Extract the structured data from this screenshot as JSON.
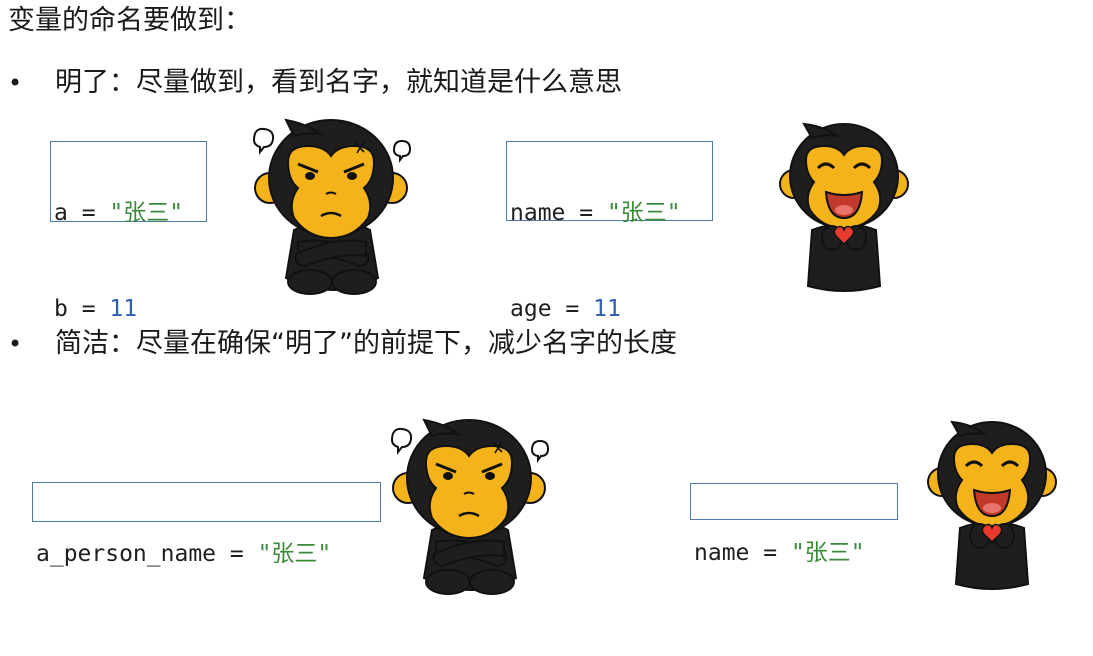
{
  "title": "变量的命名要做到：",
  "sections": [
    {
      "bullet": "•",
      "text": "明了：尽量做到，看到名字，就知道是什么意思",
      "bad_code": [
        {
          "name": "a",
          "op": " = ",
          "value": "\"张三\"",
          "kind": "str"
        },
        {
          "name": "b",
          "op": " = ",
          "value": "11",
          "kind": "num"
        }
      ],
      "good_code": [
        {
          "name": "name",
          "op": " = ",
          "value": "\"张三\"",
          "kind": "str"
        },
        {
          "name": "age",
          "op": " = ",
          "value": "11",
          "kind": "num"
        }
      ]
    },
    {
      "bullet": "•",
      "text": "简洁：尽量在确保“明了”的前提下，减少名字的长度",
      "bad_code": [
        {
          "name": "a_person_name",
          "op": " = ",
          "value": "\"张三\"",
          "kind": "str"
        }
      ],
      "good_code": [
        {
          "name": "name",
          "op": " = ",
          "value": "\"张三\"",
          "kind": "str"
        }
      ]
    }
  ],
  "colors": {
    "string": "#3a8a3a",
    "number": "#2b5fb0",
    "box_border": "#4a7aa8",
    "mascot_body": "#1e1e1e",
    "mascot_face": "#f5b31b"
  },
  "icons": [
    "angry-monkey-mascot",
    "happy-monkey-mascot"
  ]
}
